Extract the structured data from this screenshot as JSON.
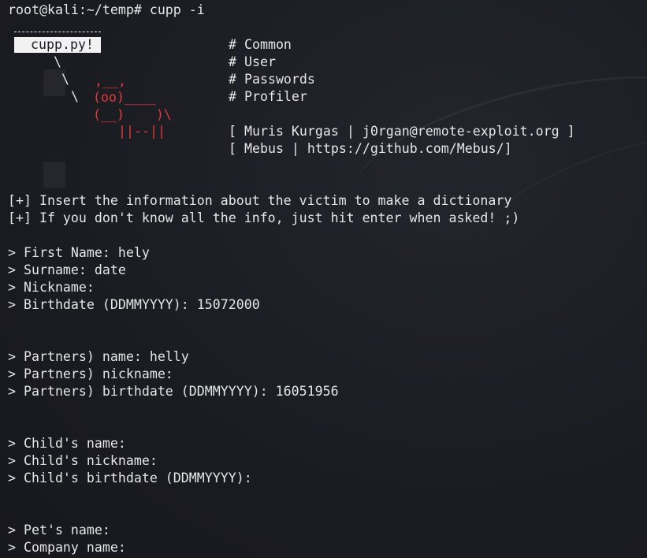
{
  "prompt_line": "root@kali:~/temp# cupp -i",
  "banner": {
    "label": "cupp.py!",
    "art": {
      "slash1": "\\",
      "slash2": "\\",
      "slash3": "\\",
      "cow_top": ",__,",
      "cow_eyes": "(oo)____",
      "cow_body": "(__)    )\\",
      "cow_legs": "||--||"
    },
    "comments": [
      "# Common",
      "# User",
      "# Passwords",
      "# Profiler"
    ],
    "credits": [
      "[ Muris Kurgas | j0rgan@remote-exploit.org ]",
      "[ Mebus | https://github.com/Mebus/]"
    ]
  },
  "info_lines": [
    "[+] Insert the information about the victim to make a dictionary",
    "[+] If you don't know all the info, just hit enter when asked! ;)"
  ],
  "prompts": {
    "victim": [
      "> First Name: hely",
      "> Surname: date",
      "> Nickname:",
      "> Birthdate (DDMMYYYY): 15072000"
    ],
    "partner": [
      "> Partners) name: helly",
      "> Partners) nickname:",
      "> Partners) birthdate (DDMMYYYY): 16051956"
    ],
    "child": [
      "> Child's name:",
      "> Child's nickname:",
      "> Child's birthdate (DDMMYYYY):"
    ],
    "other": [
      "> Pet's name:",
      "> Company name:"
    ]
  },
  "colors": {
    "background": "#1c1d23",
    "text": "#e6e6e6",
    "ascii_art": "#e03a3a",
    "banner_bg": "#f2f2f2"
  }
}
